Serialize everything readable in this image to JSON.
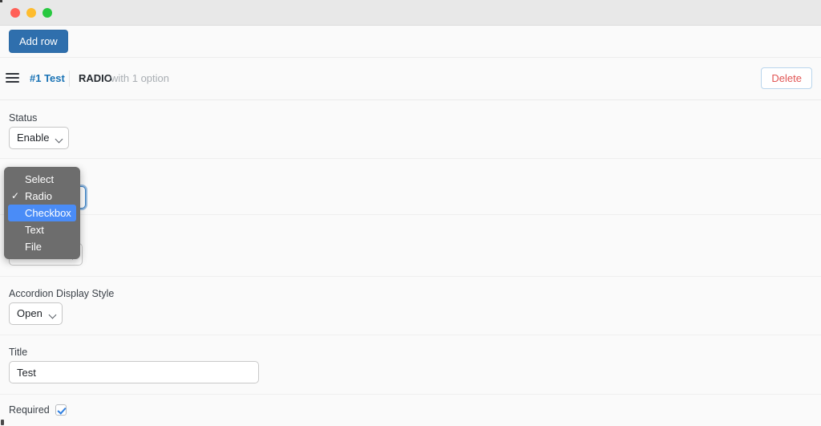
{
  "window": {
    "traffic_lights": [
      {
        "name": "close",
        "color": "#ff5f57"
      },
      {
        "name": "minimize",
        "color": "#febc2e"
      },
      {
        "name": "maximize",
        "color": "#28c840"
      }
    ]
  },
  "toolbar": {
    "add_row_label": "Add row"
  },
  "row_header": {
    "drag_handle_icon": "hamburger-drag-icon",
    "index_label": "#1 Test",
    "type_label": "RADIO",
    "description": "with 1 option",
    "delete_label": "Delete"
  },
  "fields": {
    "status": {
      "label": "Status",
      "value": "Enable"
    },
    "type": {
      "label": "",
      "value": ""
    },
    "hidden_field": {
      "label": "",
      "value": ""
    },
    "accordion": {
      "label": "Accordion Display Style",
      "value": "Open"
    },
    "title": {
      "label": "Title",
      "value": "Test",
      "placeholder": ""
    },
    "required": {
      "label": "Required",
      "checked": true
    }
  },
  "popup_menu": {
    "items": [
      {
        "label": "Select",
        "checked": false,
        "highlighted": false
      },
      {
        "label": "Radio",
        "checked": true,
        "highlighted": false
      },
      {
        "label": "Checkbox",
        "checked": false,
        "highlighted": true
      },
      {
        "label": "Text",
        "checked": false,
        "highlighted": false
      },
      {
        "label": "File",
        "checked": false,
        "highlighted": false
      }
    ]
  },
  "colors": {
    "accent_blue": "#2f6fad",
    "link_blue": "#1a73b5",
    "danger_red": "#e15554",
    "menu_bg": "#6d6d6d",
    "menu_highlight": "#4a8cf7"
  }
}
